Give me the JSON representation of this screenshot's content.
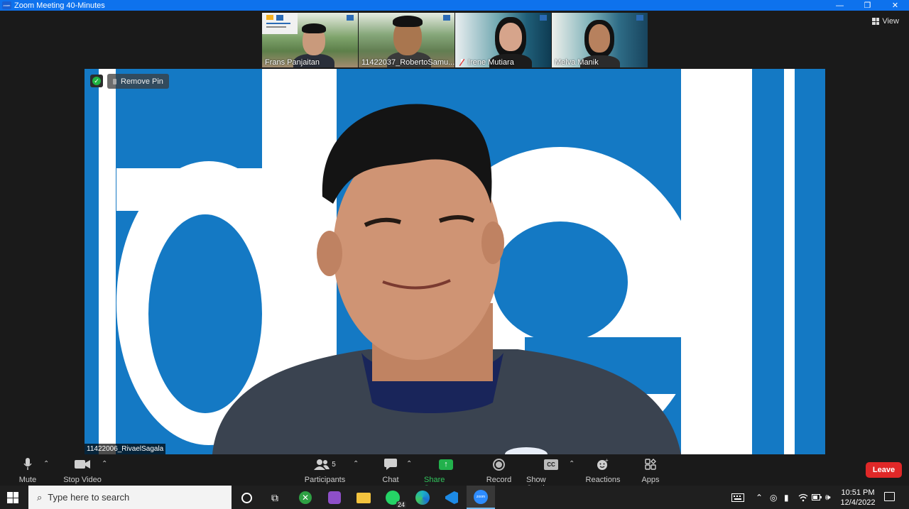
{
  "window": {
    "title": "Zoom Meeting 40-Minutes",
    "app_icon_text": "zoom",
    "controls": {
      "minimize": "—",
      "restore": "❐",
      "close": "✕"
    }
  },
  "view_button": {
    "label": "View"
  },
  "participants_strip": [
    {
      "name": "Frans Panjaitan",
      "muted": false
    },
    {
      "name": "11422037_RobertoSamu...",
      "muted": false
    },
    {
      "name": "Irene Mutiara",
      "muted": true
    },
    {
      "name": "Melva Manik",
      "muted": false
    }
  ],
  "main_video": {
    "remove_pin_label": "Remove Pin",
    "speaker_name": "11422006_RivaelSagala",
    "background_text": "del"
  },
  "toolbar": {
    "mute": "Mute",
    "stop_video": "Stop Video",
    "participants": "Participants",
    "participants_count": "5",
    "chat": "Chat",
    "share_screen": "Share Screen",
    "record": "Record",
    "show_captions": "Show Captions",
    "captions_glyph": "CC",
    "reactions": "Reactions",
    "apps": "Apps",
    "leave": "Leave"
  },
  "taskbar": {
    "search_placeholder": "Type here to search",
    "whatsapp_badge": "24",
    "zoom_app_text": "zoom",
    "time": "10:51 PM",
    "date": "12/4/2022"
  },
  "colors": {
    "title_bar": "#0e72ed",
    "share_green": "#22b14c",
    "leave_red": "#e02828",
    "main_bg_blue": "#1479c4"
  }
}
